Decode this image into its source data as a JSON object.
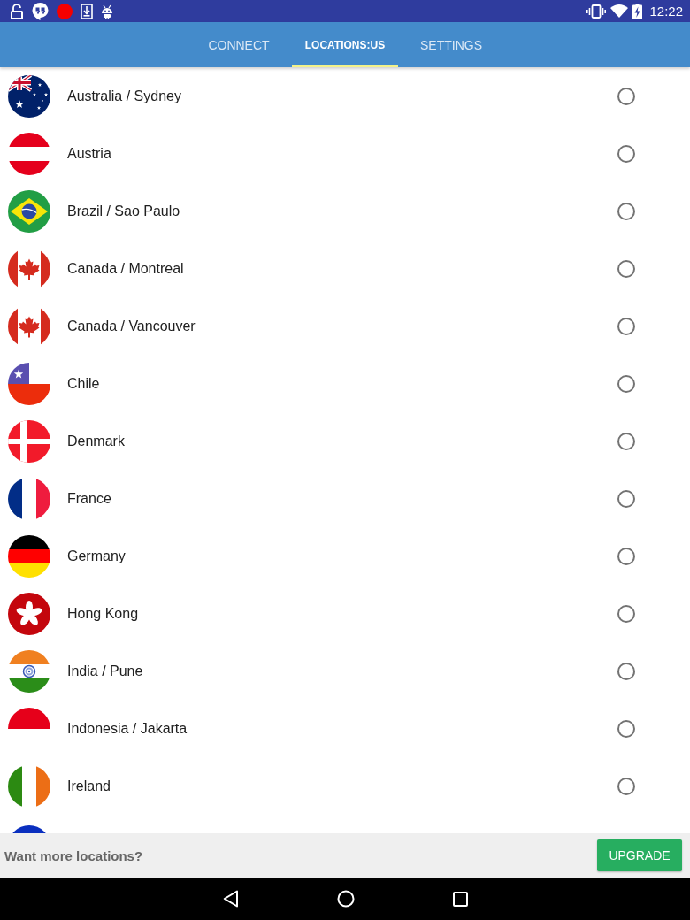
{
  "status_bar": {
    "time": "12:22"
  },
  "tabs": [
    {
      "label": "CONNECT",
      "selected": false
    },
    {
      "label": "LOCATIONS:US",
      "selected": true
    },
    {
      "label": "SETTINGS",
      "selected": false
    }
  ],
  "locations": [
    {
      "kind": "australia",
      "name": "Australia / Sydney",
      "selected": false
    },
    {
      "kind": "austria",
      "name": "Austria",
      "selected": false
    },
    {
      "kind": "brazil",
      "name": "Brazil / Sao Paulo",
      "selected": false
    },
    {
      "kind": "canada",
      "name": "Canada / Montreal",
      "selected": false
    },
    {
      "kind": "canada",
      "name": "Canada / Vancouver",
      "selected": false
    },
    {
      "kind": "chile",
      "name": "Chile",
      "selected": false
    },
    {
      "kind": "denmark",
      "name": "Denmark",
      "selected": false
    },
    {
      "kind": "france",
      "name": "France",
      "selected": false
    },
    {
      "kind": "germany",
      "name": "Germany",
      "selected": false
    },
    {
      "kind": "hongkong",
      "name": "Hong Kong",
      "selected": false
    },
    {
      "kind": "india",
      "name": "India / Pune",
      "selected": false
    },
    {
      "kind": "indonesia",
      "name": "Indonesia / Jakarta",
      "selected": false
    },
    {
      "kind": "ireland",
      "name": "Ireland",
      "selected": false
    },
    {
      "kind": "partial"
    }
  ],
  "footer": {
    "prompt": "Want more locations?",
    "button": "UPGRADE"
  }
}
